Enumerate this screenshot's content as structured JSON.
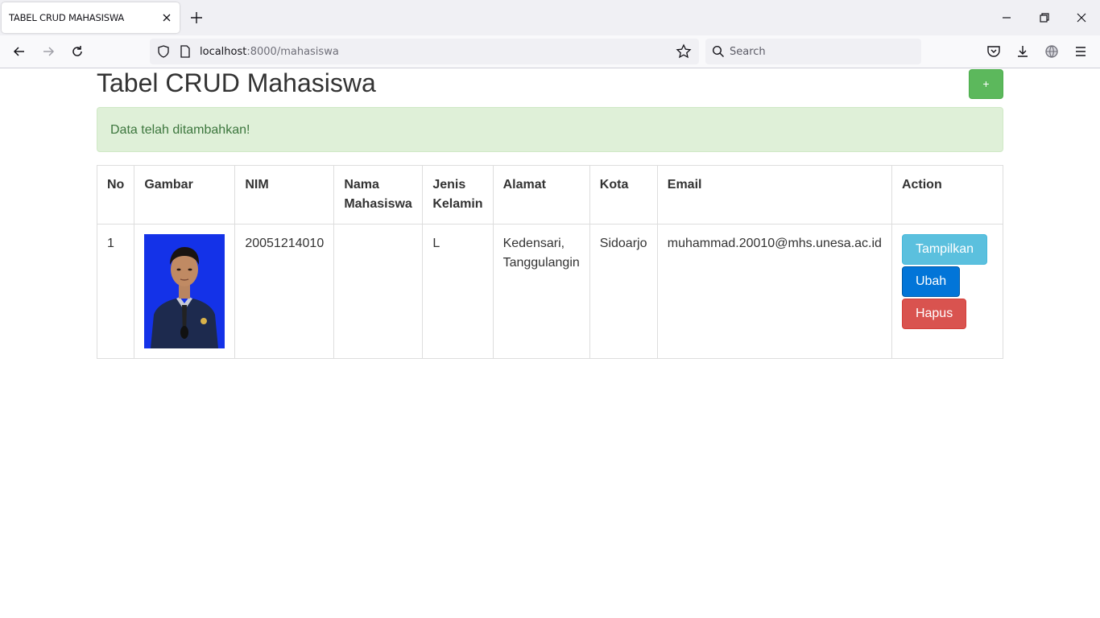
{
  "browser": {
    "tab_title": "TABEL CRUD MAHASISWA",
    "url_host": "localhost",
    "url_path": ":8000/mahasiswa",
    "search_placeholder": "Search"
  },
  "page": {
    "title": "Tabel CRUD Mahasiswa",
    "add_button_label": "+",
    "alert_message": "Data telah ditambahkan!"
  },
  "table": {
    "headers": {
      "no": "No",
      "gambar": "Gambar",
      "nim": "NIM",
      "nama_line1": "Nama",
      "nama_line2": "Mahasiswa",
      "jenis_line1": "Jenis",
      "jenis_line2": "Kelamin",
      "alamat": "Alamat",
      "kota": "Kota",
      "email": "Email",
      "action": "Action"
    },
    "rows": [
      {
        "no": "1",
        "nim": "20051214010",
        "nama": "",
        "jenis_kelamin": "L",
        "alamat_line1": "Kedensari,",
        "alamat_line2": "Tanggulangin",
        "kota": "Sidoarjo",
        "email": "muhammad.20010@mhs.unesa.ac.id",
        "actions": {
          "show": "Tampilkan",
          "edit": "Ubah",
          "delete": "Hapus"
        }
      }
    ]
  },
  "colors": {
    "success": "#5cb85c",
    "alert_bg": "#dff0d8",
    "info": "#5bc0de",
    "primary": "#0275d8",
    "danger": "#d9534f"
  }
}
